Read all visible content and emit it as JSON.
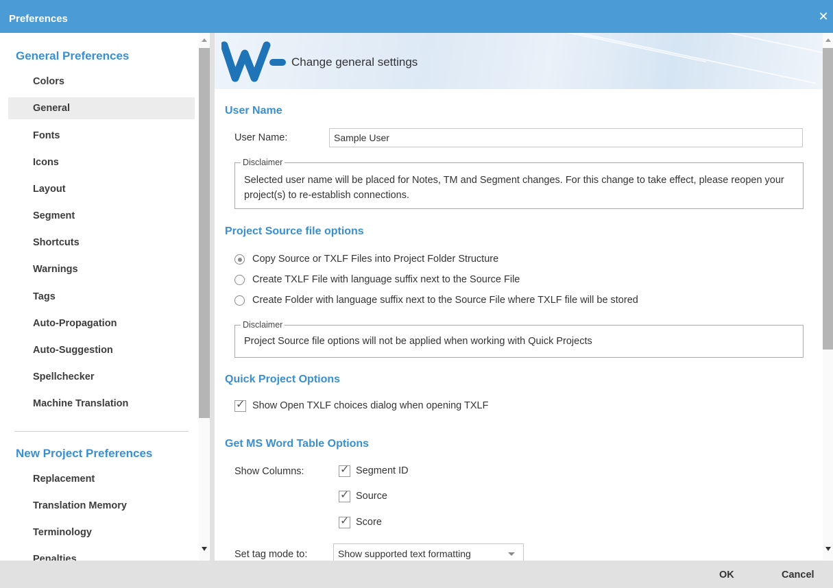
{
  "window": {
    "title": "Preferences",
    "close_icon": "close-icon"
  },
  "nav": {
    "general_title": "General Preferences",
    "general_items": [
      "Colors",
      "General",
      "Fonts",
      "Icons",
      "Layout",
      "Segment",
      "Shortcuts",
      "Warnings",
      "Tags",
      "Auto-Propagation",
      "Auto-Suggestion",
      "Spellchecker",
      "Machine Translation"
    ],
    "selected": "General",
    "project_title": "New Project Preferences",
    "project_items": [
      "Replacement",
      "Translation Memory",
      "Terminology",
      "Penalties"
    ]
  },
  "banner": {
    "logo": "WF",
    "text": "Change general settings"
  },
  "user_name": {
    "section_title": "User Name",
    "field_label": "User Name:",
    "field_value": "Sample User",
    "disclaimer_legend": "Disclaimer",
    "disclaimer_text": "Selected user name will be placed for Notes, TM and Segment changes. For this change to take effect, please reopen your project(s) to re-establish connections."
  },
  "project_source": {
    "section_title": "Project Source file options",
    "options": [
      {
        "label": "Copy Source or TXLF Files into Project Folder Structure",
        "checked": true
      },
      {
        "label": "Create TXLF File with language suffix next to the Source File",
        "checked": false
      },
      {
        "label": "Create Folder with language suffix next to the Source File where TXLF file will be stored",
        "checked": false
      }
    ],
    "disclaimer_legend": "Disclaimer",
    "disclaimer_text": "Project Source file options will not be applied when working with Quick Projects"
  },
  "quick_project": {
    "section_title": "Quick Project Options",
    "checkbox_label": "Show Open TXLF choices dialog when opening TXLF",
    "checked": true
  },
  "ms_word": {
    "section_title": "Get MS Word Table Options",
    "columns_label": "Show Columns:",
    "columns": [
      {
        "label": "Segment ID",
        "checked": true
      },
      {
        "label": "Source",
        "checked": true
      },
      {
        "label": "Score",
        "checked": true
      }
    ],
    "tag_mode_label": "Set tag mode to:",
    "tag_mode_value": "Show supported text formatting"
  },
  "footer": {
    "ok_label": "OK",
    "cancel_label": "Cancel"
  },
  "colors": {
    "titlebar": "#4a9bd6",
    "accent": "#3a8fd0",
    "logo": "#1f74b8"
  }
}
